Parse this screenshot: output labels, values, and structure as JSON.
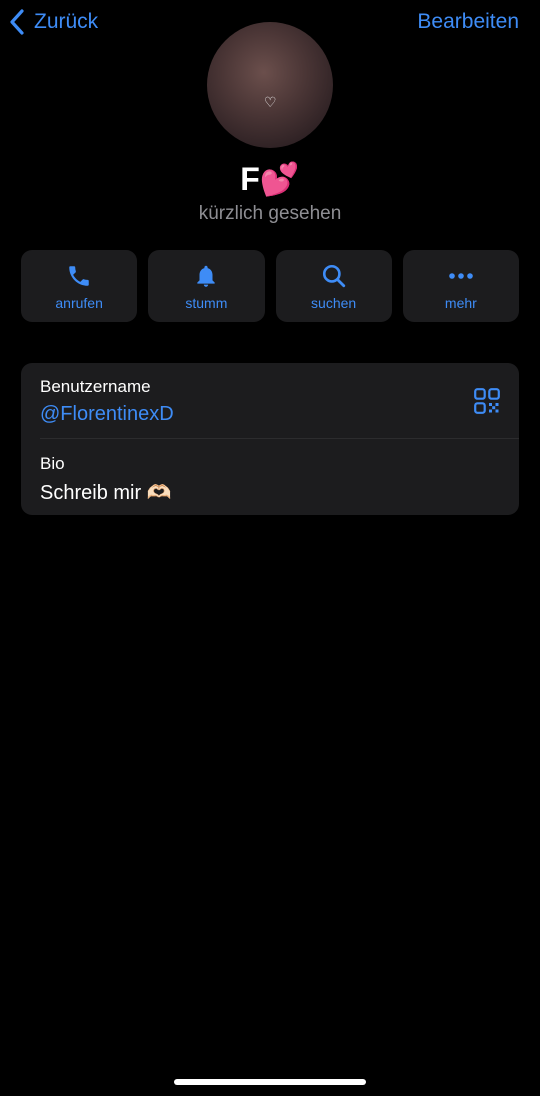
{
  "nav": {
    "back_label": "Zurück",
    "edit_label": "Bearbeiten"
  },
  "profile": {
    "avatar_heart": "♡",
    "name": "F💕",
    "status": "kürzlich gesehen"
  },
  "actions": [
    {
      "label": "anrufen",
      "icon": "phone-icon"
    },
    {
      "label": "stumm",
      "icon": "bell-icon"
    },
    {
      "label": "suchen",
      "icon": "search-icon"
    },
    {
      "label": "mehr",
      "icon": "more-icon"
    }
  ],
  "info": {
    "username_label": "Benutzername",
    "username": "@FlorentinexD",
    "bio_label": "Bio",
    "bio": "Schreib mir 🫶🏻"
  },
  "colors": {
    "accent": "#3e8cf6",
    "card": "#1c1c1e",
    "background": "#000000",
    "secondary_text": "#8e8e93"
  }
}
